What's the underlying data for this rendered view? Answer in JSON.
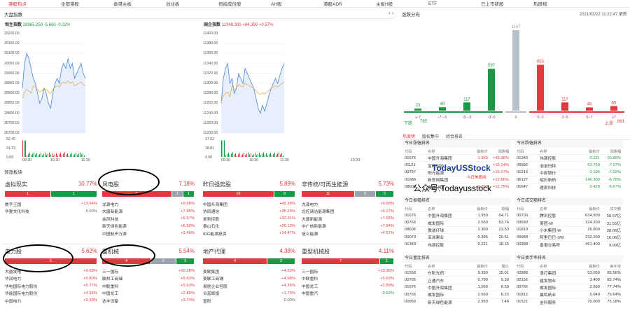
{
  "nav": [
    "港股热点",
    "全部港股",
    "香港主板",
    "创业板",
    "恒指成份股",
    "AH股",
    "港股ADR",
    "主板H股",
    "ETF",
    "已上市新股",
    "热度榜"
  ],
  "market_panel": {
    "title": "大盘指数"
  },
  "hsi": {
    "name": "恒生指数",
    "value": "28965.250",
    "change": "-5.660",
    "pct": "-0.02%",
    "y_ticks": [
      "29200.00",
      "29150.00",
      "29100.00",
      "29050.00",
      "29000.00",
      "28950.00",
      "28900.00",
      "28850.00",
      "28800.00",
      "28750.00",
      "28700.00"
    ],
    "vol_ticks": [
      "62.46",
      "31.23",
      "0.00"
    ],
    "x_ticks": [
      "09:30",
      "10:30",
      "11:30"
    ]
  },
  "hsci": {
    "name": "国企指数",
    "value": "11348.300",
    "change": "+64.350",
    "pct": "+0.57%",
    "y_ticks": [
      "11400.00",
      "11380.00",
      "11360.00",
      "11340.00",
      "11320.00",
      "11300.00",
      "11280.00",
      "11260.00",
      "11240.00",
      "11220.00",
      "11200.00"
    ],
    "vol_ticks": [
      "37.62",
      "18.81",
      "0.00"
    ],
    "x_ticks": [
      "09:30",
      "10:30",
      "11:30",
      "15:00"
    ]
  },
  "distribution": {
    "title": "涨跌分布",
    "datetime": "2021/03/22 11:22:47",
    "more": "更新",
    "chart_data": {
      "type": "bar",
      "categories": [
        "≤-7",
        "-7~-5",
        "-5~-3",
        "-3~0",
        "0",
        "0~3",
        "3~5",
        "5~7",
        "≥7"
      ],
      "values": [
        23,
        48,
        117,
        597,
        1147,
        653,
        117,
        46,
        65
      ]
    },
    "down_label": "下跌",
    "down_count": "785",
    "up_label": "上涨",
    "up_count": "881"
  },
  "sectors_title": "领涨板块",
  "sectors": [
    {
      "name": "虚拟现实",
      "pct": "10.77%",
      "bars": [
        [
          "1",
          "#e0393e",
          66
        ],
        [
          "1",
          "#1a9a44",
          66
        ]
      ],
      "rows": [
        [
          "数字王国",
          "+13.64%",
          "red"
        ],
        [
          "华夏文化科技",
          "0.00%",
          "gray"
        ]
      ]
    },
    {
      "name": "风电股",
      "pct": "7.18%",
      "bars": [
        [
          "5",
          "#e0393e",
          100
        ],
        [
          "1",
          "#9aa3ae",
          16
        ],
        [
          "1",
          "#1a9a44",
          16
        ]
      ],
      "rows": [
        [
          "龙源电力",
          "+9.68%",
          "red"
        ],
        [
          "大唐新能源",
          "+7.95%",
          "red"
        ],
        [
          "金风科技",
          "+6.57%",
          "red"
        ],
        [
          "新天绿色能源",
          "+6.50%",
          "red"
        ],
        [
          "中国航天万源",
          "+2.46%",
          "red"
        ]
      ]
    },
    {
      "name": "昨日强势股",
      "pct": "5.89%",
      "bars": [
        [
          "16",
          "#e0393e",
          102
        ],
        [
          "8",
          "#1a9a44",
          30
        ]
      ],
      "rows": [
        [
          "中国升海集团",
          "+43.38%",
          "red"
        ],
        [
          "协同通信",
          "+35.29%",
          "red"
        ],
        [
          "爱利控股",
          "+32.31%",
          "red"
        ],
        [
          "泰山石化",
          "+26.13%",
          "red"
        ],
        [
          "IDG能源投资",
          "+14.47%",
          "red"
        ]
      ]
    },
    {
      "name": "非传统/可再生能源",
      "pct": "5.73%",
      "bars": [
        [
          "11",
          "#e0393e",
          76
        ],
        [
          "8",
          "#9aa3ae",
          30
        ],
        [
          "5",
          "#1a9a44",
          26
        ]
      ],
      "rows": [
        [
          "龙源电力",
          "+9.68%",
          "red"
        ],
        [
          "北控清洁能源集团",
          "+9.17%",
          "red"
        ],
        [
          "大唐新能源",
          "+7.95%",
          "red"
        ],
        [
          "中广核新能源",
          "+7.54%",
          "red"
        ],
        [
          "信义能源",
          "+4.57%",
          "red"
        ]
      ]
    },
    {
      "name": "电力股",
      "pct": "5.62%",
      "bars": [
        [
          "5",
          "#e0393e",
          132
        ]
      ],
      "rows": [
        [
          "大唐发电",
          "+9.68%",
          "red"
        ],
        [
          "华润电力",
          "+5.80%",
          "red"
        ],
        [
          "华电国际电力股份",
          "+5.77%",
          "red"
        ],
        [
          "华能国际电力股份",
          "+4.55%",
          "red"
        ],
        [
          "中国电力",
          "+3.39%",
          "red"
        ]
      ]
    },
    {
      "name": "重机械",
      "pct": "5.54%",
      "bars": [
        [
          "4",
          "#e0393e",
          70
        ],
        [
          "5",
          "#9aa3ae",
          36
        ],
        [
          "3",
          "#1a9a44",
          26
        ]
      ],
      "rows": [
        [
          "三一国际",
          "+10.38%",
          "red"
        ],
        [
          "联邦工商储",
          "+5.63%",
          "red"
        ],
        [
          "中联重科",
          "+5.63%",
          "red"
        ],
        [
          "中国龙工",
          "+2.89%",
          "red"
        ],
        [
          "达丰设备",
          "+2.74%",
          "red"
        ]
      ]
    },
    {
      "name": "地产代理",
      "pct": "4.38%",
      "bars": [
        [
          "4",
          "#e0393e",
          92
        ],
        [
          "2",
          "#1a9a44",
          40
        ]
      ],
      "rows": [
        [
          "美联集团",
          "+4.63%",
          "red"
        ],
        [
          "美联工商铺",
          "+4.58%",
          "red"
        ],
        [
          "易居企业控股",
          "+4.36%",
          "red"
        ],
        [
          "合富辉煌",
          "+1.79%",
          "red"
        ],
        [
          "富阳",
          "0.00%",
          "gray"
        ]
      ]
    },
    {
      "name": "重型机械股",
      "pct": "4.11%",
      "bars": [
        [
          "7",
          "#e0393e",
          112
        ],
        [
          "1",
          "#1a9a44",
          20
        ]
      ],
      "rows": [
        [
          "三一国际",
          "+10.38%",
          "red"
        ],
        [
          "中联重科",
          "+5.63%",
          "red"
        ],
        [
          "中国龙工",
          "+2.89%",
          "red"
        ],
        [
          "中国重汽",
          "-0.62%",
          "green"
        ]
      ]
    }
  ],
  "rank_tabs": [
    "热度榜",
    "股权集中",
    "综合排名"
  ],
  "tables": [
    {
      "title": "今日涨幅排名",
      "cols": [
        "代码",
        "名称",
        "最新价",
        "涨跌幅"
      ],
      "rows": [
        [
          "01676",
          "中国升海集团",
          "1.950",
          "+43.38%",
          "red"
        ],
        [
          "01121",
          "宝峰时尚",
          "",
          "+15.14%",
          "red"
        ],
        [
          "00757",
          "阳光能源",
          "",
          "+15.07%",
          "red"
        ],
        [
          "01686",
          "新意网集团",
          "",
          "+12.86%",
          "red"
        ],
        [
          "08606",
          "傲迪环球",
          "2.300",
          "+12.75%",
          "red"
        ]
      ]
    },
    {
      "title": "今日跌幅排名",
      "cols": [
        "代码",
        "名称",
        "最新价",
        "涨跌幅"
      ],
      "rows": [
        [
          "01343",
          "伟源控股",
          "0.221",
          "-10.89%",
          "green"
        ],
        [
          "09992",
          "泡泡玛特",
          "63.750",
          "-7.07%",
          "green"
        ],
        [
          "01216",
          "中原银行",
          "0.106",
          "-7.02%",
          "green"
        ],
        [
          "06127",
          "昭衍新药",
          "140.300",
          "-6.78%",
          "green"
        ],
        [
          "01647",
          "建泉科技",
          "0.420",
          "-6.67%",
          "green"
        ]
      ]
    },
    {
      "title": "今日振幅排名",
      "cols": [
        "代码",
        "名称",
        "最新价",
        "振幅"
      ],
      "rows": [
        [
          "01676",
          "中国升海集团",
          "1.950",
          "64.71"
        ],
        [
          "00765",
          "威发国际",
          "2.560",
          "63.74"
        ],
        [
          "08606",
          "傲迪环球",
          "2.300",
          "23.53"
        ],
        [
          "00073",
          "亚洲果业",
          "0.395",
          "20.51"
        ],
        [
          "01343",
          "伟源控股",
          "0.221",
          "18.15"
        ]
      ]
    },
    {
      "title": "今日成交额排名",
      "cols": [
        "代码",
        "名称",
        "最新价",
        "成交额"
      ],
      "rows": [
        [
          "00700",
          "腾讯控股",
          "634.500",
          "50.57亿"
        ],
        [
          "03690",
          "美团-W",
          "324.200",
          "31.55亿"
        ],
        [
          "01810",
          "小米集团-W",
          "26.800",
          "28.06亿"
        ],
        [
          "09988",
          "阿里巴巴-SW",
          "232.200",
          "16.06亿"
        ],
        [
          "00388",
          "香港交易所",
          "461.400",
          "9.99亿"
        ]
      ]
    },
    {
      "title": "今日量比排名",
      "cols": [
        "代码",
        "名称",
        "最新价",
        "量比"
      ],
      "rows": [
        [
          "01558",
          "东阳光药",
          "9.390",
          "15.01"
        ],
        [
          "00765",
          "正通汽车",
          "0.790",
          "9.30"
        ],
        [
          "01676",
          "中国升海集团",
          "1.950",
          "8.59"
        ],
        [
          "00765",
          "威发国际",
          "2.560",
          "8.23"
        ],
        [
          "00956",
          "新天绿色能源",
          "2.950",
          "7.46"
        ]
      ]
    },
    {
      "title": "今日换手率排名",
      "cols": [
        "代码",
        "名称",
        "最新价",
        "换手率"
      ],
      "rows": [
        [
          "02888",
          "渣打集团",
          "53.050",
          "85.56%"
        ],
        [
          "02156",
          "建发物业",
          "3.400",
          "83.74%"
        ],
        [
          "00765",
          "威发国际",
          "2.560",
          "77.74%"
        ],
        [
          "01812",
          "晨鸣纸业",
          "5.040",
          "76.64%"
        ],
        [
          "01521",
          "金科服务",
          "70.000",
          "75.18%"
        ]
      ]
    }
  ],
  "watermark": {
    "brand": "TodayUSStock",
    "sub": "今日美股网",
    "account": "公众号:Todayusstock"
  }
}
